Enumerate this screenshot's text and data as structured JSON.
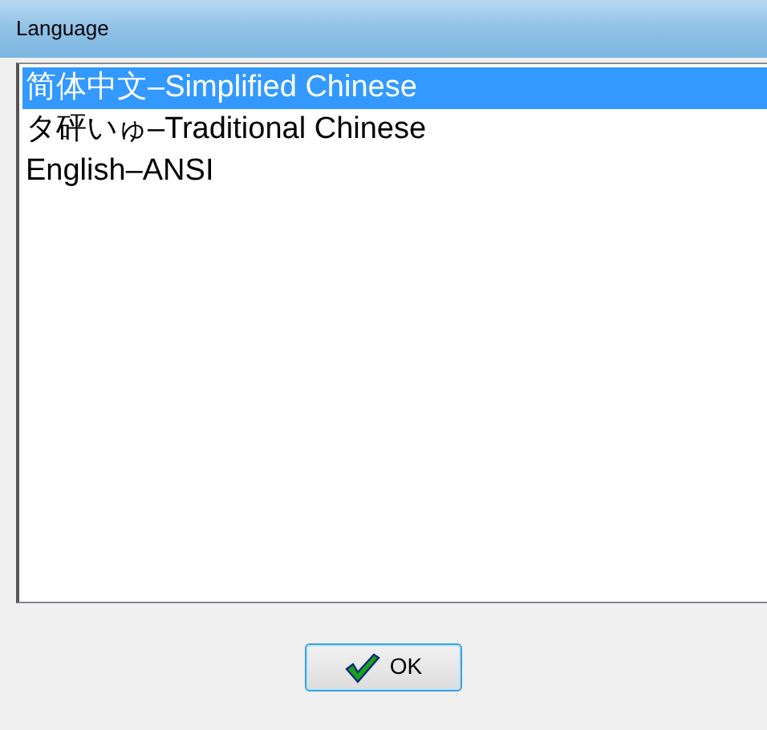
{
  "window": {
    "title": "Language"
  },
  "languages": [
    {
      "label": "简体中文–Simplified Chinese",
      "selected": true
    },
    {
      "label": "タ砰いゅ–Traditional Chinese",
      "selected": false
    },
    {
      "label": "English–ANSI",
      "selected": false
    }
  ],
  "buttons": [
    {
      "label": "OK"
    }
  ]
}
